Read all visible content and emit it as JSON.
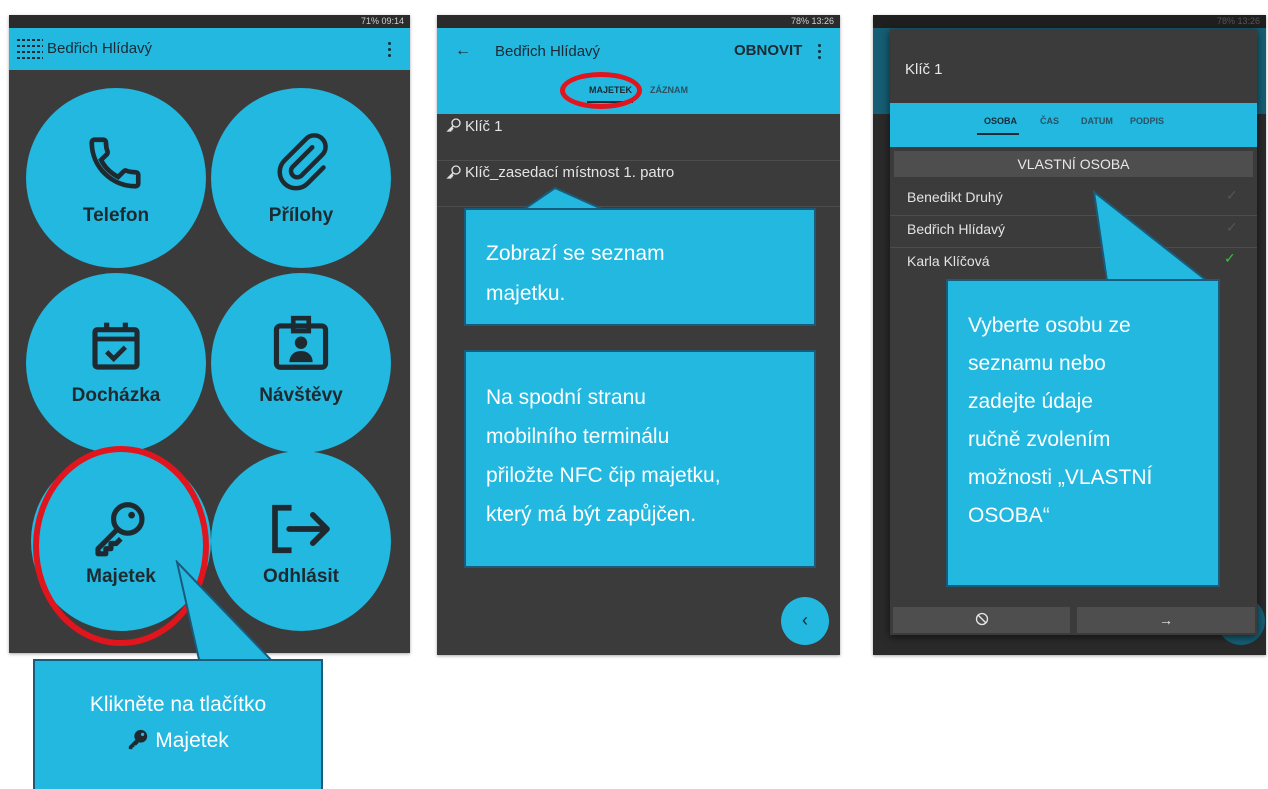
{
  "screen1": {
    "status": "71% 09:14",
    "title": "Bedřich Hlídavý",
    "buttons": [
      {
        "label": "Telefon",
        "icon": "phone-icon"
      },
      {
        "label": "Přílohy",
        "icon": "paperclip-icon"
      },
      {
        "label": "Docházka",
        "icon": "calendar-check-icon"
      },
      {
        "label": "Návštěvy",
        "icon": "badge-icon"
      },
      {
        "label": "Majetek",
        "icon": "key-icon"
      },
      {
        "label": "Odhlásit",
        "icon": "logout-icon"
      }
    ],
    "callout_line1": "Klikněte na tlačítko",
    "callout_line2": "Majetek"
  },
  "screen2": {
    "status": "78% 13:26",
    "title": "Bedřich Hlídavý",
    "refresh": "OBNOVIT",
    "tabs": [
      "MAJETEK",
      "ZÁZNAM"
    ],
    "items": [
      "Klíč 1",
      "Klíč_zasedací místnost 1. patro"
    ],
    "callout1_lines": [
      "Zobrazí se seznam",
      "majetku."
    ],
    "callout2_lines": [
      "Na spodní stranu",
      "mobilního terminálu",
      "přiložte NFC čip majetku,",
      "který má být zapůjčen."
    ]
  },
  "screen3": {
    "status": "78% 13:26",
    "title": "Klíč 1",
    "tabs": [
      "OSOBA",
      "ČAS",
      "DATUM",
      "PODPIS"
    ],
    "own_person": "VLASTNÍ OSOBA",
    "persons": [
      "Benedikt Druhý",
      "Bedřich Hlídavý",
      "Karla Klíčová"
    ],
    "callout_lines": [
      "Vyberte osobu ze",
      "seznamu nebo",
      "zadejte údaje",
      "ručně zvolením",
      "možnosti „VLASTNÍ",
      "OSOBA“"
    ]
  },
  "colors": {
    "accent": "#22b8e0",
    "background": "#3b3b3b",
    "highlight": "#e0151d",
    "check": "#3ac23a"
  }
}
